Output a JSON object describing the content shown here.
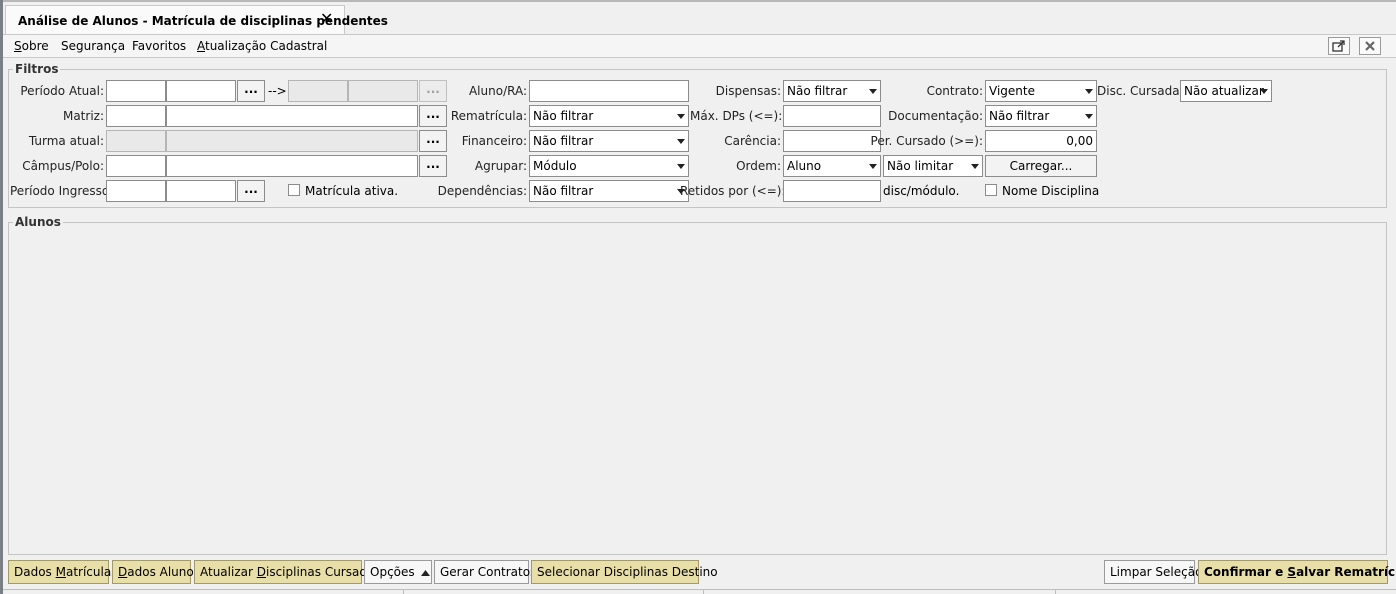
{
  "tab": {
    "title": "Análise de Alunos - Matrícula de disciplinas pendentes",
    "close_glyph": "✕"
  },
  "menu": {
    "sobre_mnemonic": "S",
    "sobre_rest": "obre",
    "seguranca": "Segurança",
    "favoritos": "Favoritos",
    "atualizacao_mnemonic": "A",
    "atualizacao_rest": "tualização Cadastral"
  },
  "window_buttons": {
    "detach_icon": "external-link-icon",
    "close_icon": "close-icon"
  },
  "filtros": {
    "legend": "Filtros",
    "periodo_atual": "Período Atual:",
    "arrow": "-->",
    "matriz": "Matriz:",
    "turma_atual": "Turma atual:",
    "campus_polo": "Câmpus/Polo:",
    "periodo_ingresso": "Período Ingresso:",
    "matricula_ativa": "Matrícula ativa.",
    "aluno_ra": "Aluno/RA:",
    "rematricula": "Rematrícula:",
    "rematricula_value": "Não filtrar",
    "financeiro": "Financeiro:",
    "financeiro_value": "Não filtrar",
    "agrupar": "Agrupar:",
    "agrupar_value": "Módulo",
    "dependencias": "Dependências:",
    "dependencias_value": "Não filtrar",
    "dispensas": "Dispensas:",
    "dispensas_value": "Não filtrar",
    "max_dps": "Máx. DPs (<=):",
    "carencia": "Carência:",
    "ordem": "Ordem:",
    "ordem_value": "Aluno",
    "limitar_value": "Não limitar",
    "retidos": "Retidos por (<=):",
    "disc_modulo": "disc/módulo.",
    "contrato": "Contrato:",
    "contrato_value": "Vigente",
    "documentacao": "Documentação:",
    "documentacao_value": "Não filtrar",
    "per_cursado": "Per. Cursado (>=):",
    "per_cursado_value": "0,00",
    "carregar": "Carregar...",
    "nome_disciplina": "Nome Disciplina",
    "disc_cursadas": "Disc. Cursadas:",
    "disc_cursadas_value": "Não atualizar",
    "ellipsis": "..."
  },
  "alunos": {
    "legend": "Alunos"
  },
  "bottom": {
    "dados_matriculas_a": "Dados ",
    "dados_matriculas_m": "M",
    "dados_matriculas_b": "atrículas",
    "dados_aluno_a": "D",
    "dados_aluno_b": "ados Aluno",
    "atualizar_a": "Atualizar ",
    "atualizar_m": "D",
    "atualizar_b": "isciplinas Cursadas",
    "opcoes": "Opções",
    "gerar_contratos": "Gerar Contratos",
    "selecionar": "Selecionar Disciplinas Destino",
    "limpar": "Limpar Seleção",
    "confirmar_a": "Confirmar e ",
    "confirmar_m": "S",
    "confirmar_b": "alvar Rematrículas"
  }
}
